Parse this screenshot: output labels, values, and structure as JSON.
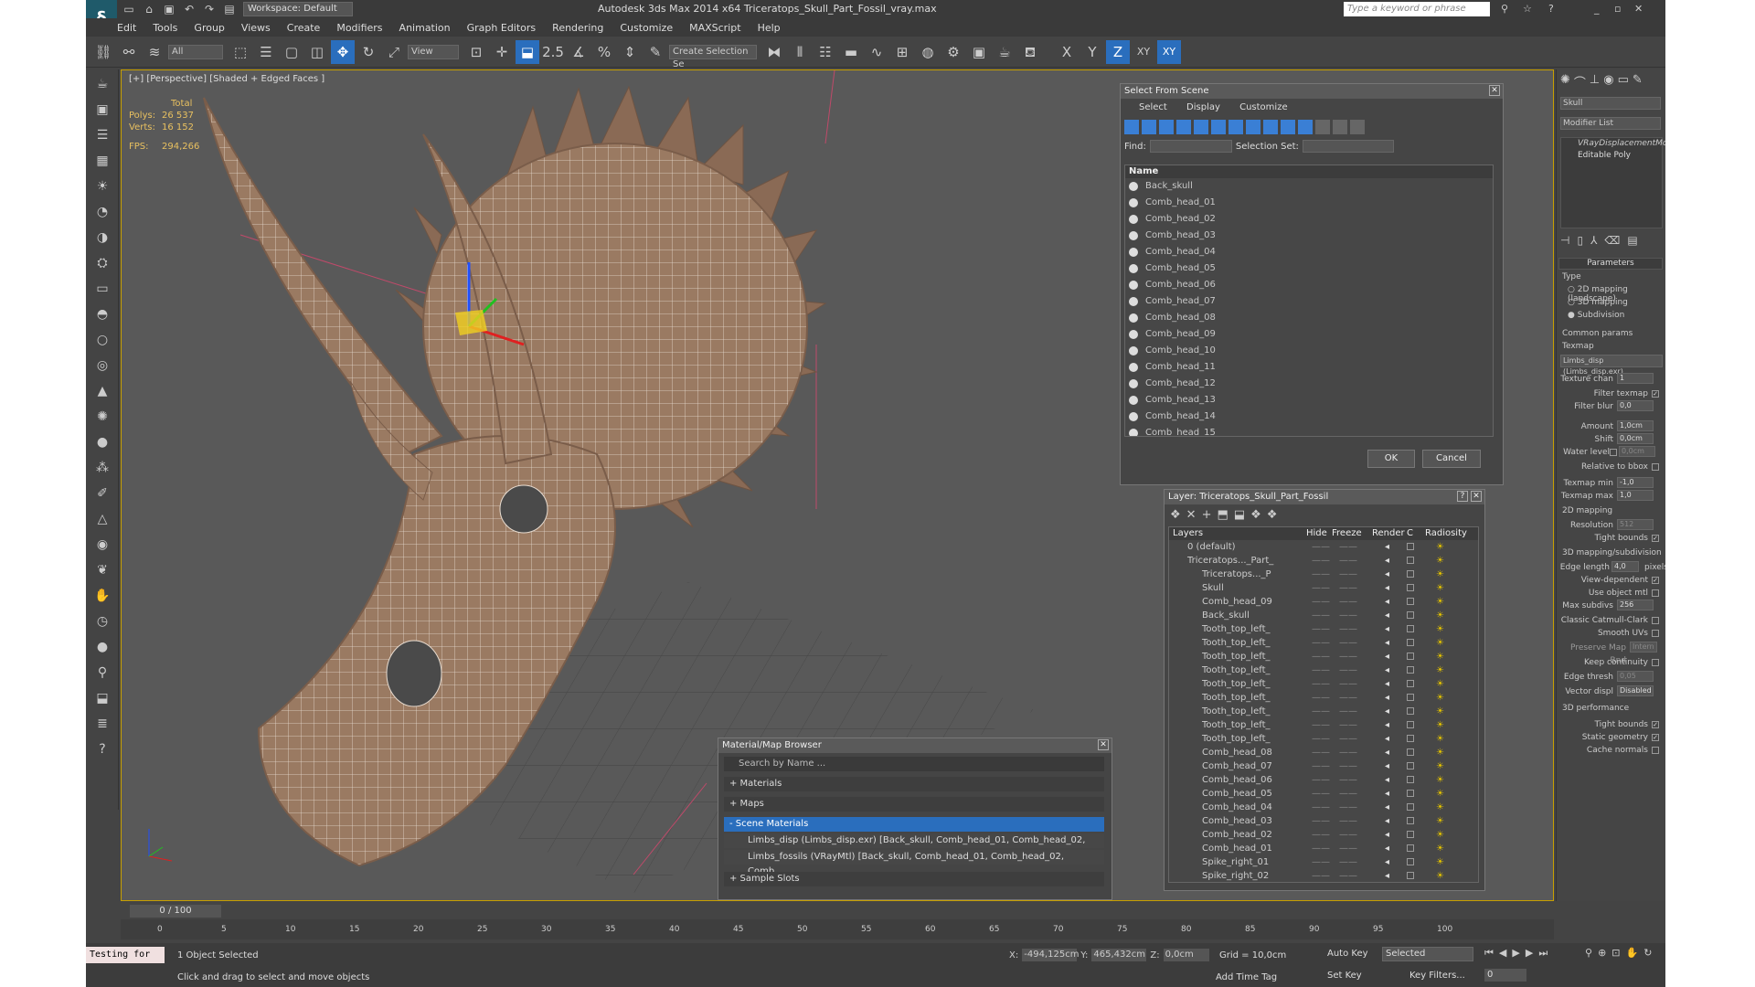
{
  "app": {
    "title": "Autodesk 3ds Max  2014 x64     Triceratops_Skull_Part_Fossil_vray.max",
    "workspace": "Workspace: Default",
    "search_placeholder": "Type a keyword or phrase"
  },
  "menu": [
    "Edit",
    "Tools",
    "Group",
    "Views",
    "Create",
    "Modifiers",
    "Animation",
    "Graph Editors",
    "Rendering",
    "Customize",
    "MAXScript",
    "Help"
  ],
  "toolbar": {
    "filter": "All",
    "view": "View",
    "snap_value": "2.5",
    "selection_set": "Create Selection Se",
    "axes": [
      "X",
      "Y",
      "Z",
      "XY",
      "XY"
    ]
  },
  "viewport": {
    "label": "[+] [Perspective] [Shaded + Edged Faces ]",
    "stats": {
      "header": "Total",
      "polys_label": "Polys:",
      "polys": "26 537",
      "verts_label": "Verts:",
      "verts": "16 152",
      "fps_label": "FPS:",
      "fps": "294,266"
    }
  },
  "select_from_scene": {
    "title": "Select From Scene",
    "tabs": [
      "Select",
      "Display",
      "Customize"
    ],
    "find_label": "Find:",
    "selection_set_label": "Selection Set:",
    "column": "Name",
    "items": [
      "Back_skull",
      "Comb_head_01",
      "Comb_head_02",
      "Comb_head_03",
      "Comb_head_04",
      "Comb_head_05",
      "Comb_head_06",
      "Comb_head_07",
      "Comb_head_08",
      "Comb_head_09",
      "Comb_head_10",
      "Comb_head_11",
      "Comb_head_12",
      "Comb_head_13",
      "Comb_head_14",
      "Comb_head_15"
    ],
    "ok": "OK",
    "cancel": "Cancel"
  },
  "layer_dialog": {
    "title": "Layer: Triceratops_Skull_Part_Fossil",
    "help": "?",
    "columns": [
      "Layers",
      "Hide",
      "Freeze",
      "Render",
      "C",
      "Radiosity"
    ],
    "rows": [
      {
        "name": "0 (default)",
        "indent": 1
      },
      {
        "name": "Triceratops..._Part_",
        "indent": 1
      },
      {
        "name": "Triceratops..._P",
        "indent": 2
      },
      {
        "name": "Skull",
        "indent": 2
      },
      {
        "name": "Comb_head_09",
        "indent": 2
      },
      {
        "name": "Back_skull",
        "indent": 2
      },
      {
        "name": "Tooth_top_left_",
        "indent": 2
      },
      {
        "name": "Tooth_top_left_",
        "indent": 2
      },
      {
        "name": "Tooth_top_left_",
        "indent": 2
      },
      {
        "name": "Tooth_top_left_",
        "indent": 2
      },
      {
        "name": "Tooth_top_left_",
        "indent": 2
      },
      {
        "name": "Tooth_top_left_",
        "indent": 2
      },
      {
        "name": "Tooth_top_left_",
        "indent": 2
      },
      {
        "name": "Tooth_top_left_",
        "indent": 2
      },
      {
        "name": "Tooth_top_left_",
        "indent": 2
      },
      {
        "name": "Comb_head_08",
        "indent": 2
      },
      {
        "name": "Comb_head_07",
        "indent": 2
      },
      {
        "name": "Comb_head_06",
        "indent": 2
      },
      {
        "name": "Comb_head_05",
        "indent": 2
      },
      {
        "name": "Comb_head_04",
        "indent": 2
      },
      {
        "name": "Comb_head_03",
        "indent": 2
      },
      {
        "name": "Comb_head_02",
        "indent": 2
      },
      {
        "name": "Comb_head_01",
        "indent": 2
      },
      {
        "name": "Spike_right_01",
        "indent": 2
      },
      {
        "name": "Spike_right_02",
        "indent": 2
      }
    ]
  },
  "material_browser": {
    "title": "Material/Map Browser",
    "search_placeholder": "Search by Name ...",
    "sections": [
      "+ Materials",
      "+ Maps",
      "- Scene Materials"
    ],
    "entries": [
      "Limbs_disp (Limbs_disp.exr) [Back_skull, Comb_head_01, Comb_head_02, Com...",
      "Limbs_fossils (VRayMtl) [Back_skull, Comb_head_01, Comb_head_02, Comb_..."
    ],
    "sample_slots": "+ Sample Slots"
  },
  "command_panel": {
    "object_name": "Skull",
    "modifier_list": "Modifier List",
    "stack": [
      "VRayDisplacementMod",
      "Editable Poly"
    ],
    "parameters": "Parameters",
    "type_label": "Type",
    "types": [
      "2D mapping (landscape)",
      "3D mapping",
      "Subdivision"
    ],
    "common_params": "Common params",
    "texmap_label": "Texmap",
    "texmap": "Limbs_disp (Limbs_disp.exr)",
    "texture_chan": {
      "label": "Texture chan",
      "value": "1"
    },
    "filter_texmap": "Filter texmap",
    "filter_blur": {
      "label": "Filter blur",
      "value": "0,0"
    },
    "amount": {
      "label": "Amount",
      "value": "1,0cm"
    },
    "shift": {
      "label": "Shift",
      "value": "0,0cm"
    },
    "water_level": {
      "label": "Water level",
      "value": "0,0cm"
    },
    "relative_to_bbox": "Relative to bbox",
    "texmap_min": {
      "label": "Texmap min",
      "value": "-1,0"
    },
    "texmap_max": {
      "label": "Texmap max",
      "value": "1,0"
    },
    "mapping2d": "2D mapping",
    "resolution": {
      "label": "Resolution",
      "value": "512"
    },
    "tight_bounds": "Tight bounds",
    "mapping3d": "3D mapping/subdivision",
    "edge_length": {
      "label": "Edge length",
      "value": "4,0",
      "unit": "pixels"
    },
    "view_dependent": "View-dependent",
    "use_object_mtl": "Use object mtl",
    "max_subdivs": {
      "label": "Max subdivs",
      "value": "256"
    },
    "classic_catmull": "Classic Catmull-Clark",
    "smooth_uvs": "Smooth UVs",
    "preserve_map": {
      "label": "Preserve Map Bnd",
      "value": "Intern"
    },
    "keep_continuity": "Keep continuity",
    "edge_thresh": {
      "label": "Edge thresh",
      "value": "0,05"
    },
    "vector_displ": {
      "label": "Vector displ",
      "value": "Disabled"
    },
    "perf": "3D performance",
    "tight_bounds2": "Tight bounds",
    "static_geometry": "Static geometry",
    "cache_normals": "Cache normals"
  },
  "timeline": {
    "frame": "0 / 100",
    "ticks": [
      "0",
      "5",
      "10",
      "15",
      "20",
      "25",
      "30",
      "35",
      "40",
      "45",
      "50",
      "55",
      "60",
      "65",
      "70",
      "75",
      "80",
      "85",
      "90",
      "95",
      "100"
    ]
  },
  "status": {
    "script": "Testing for",
    "selected": "1 Object Selected",
    "hint": "Click and drag to select and move objects",
    "x_label": "X:",
    "x": "-494,125cm",
    "y_label": "Y:",
    "y": "465,432cm",
    "z_label": "Z:",
    "z": "0,0cm",
    "grid": "Grid = 10,0cm",
    "add_time_tag": "Add Time Tag",
    "auto_key": "Auto Key",
    "set_key": "Set Key",
    "key_mode": "Selected",
    "key_filters": "Key Filters...",
    "frame_field": "0"
  }
}
